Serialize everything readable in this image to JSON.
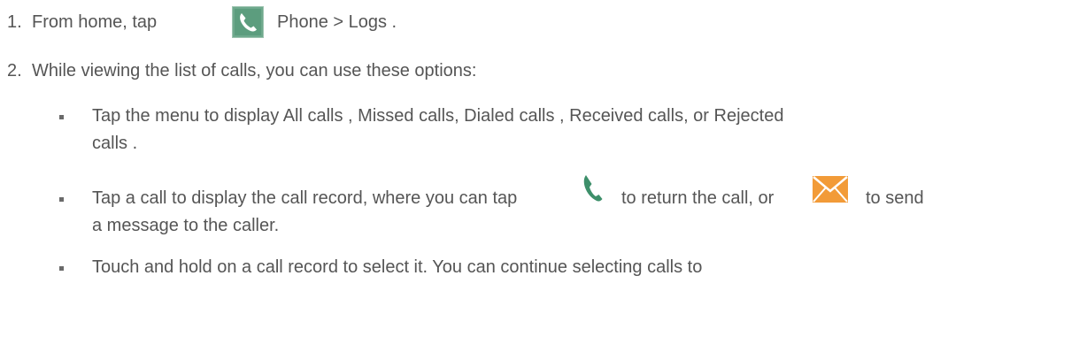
{
  "steps": [
    {
      "number": "1.",
      "before_icon": "From home, tap",
      "icon": "phone-app-icon",
      "after_icon": "Phone > Logs ."
    },
    {
      "number": "2.",
      "text": "While viewing the list of calls, you can use these options:"
    }
  ],
  "bullets": [
    {
      "line1": "Tap the menu to display All calls  , Missed calls,   Dialed calls  , Received calls,   or Rejected",
      "line2": "calls ."
    },
    {
      "part1": "Tap a call to display the call record, where you can tap",
      "icon1": "phone-icon",
      "part2": "to return the call, or",
      "icon2": "envelope-icon",
      "part3": "to send",
      "line2": "a message to the caller."
    },
    {
      "line1": "Touch and hold on a call record to select it. You can continue selecting calls to"
    }
  ],
  "colors": {
    "text": "#555555",
    "phone_green": "#3d8f6a",
    "envelope_orange": "#f29b38"
  }
}
